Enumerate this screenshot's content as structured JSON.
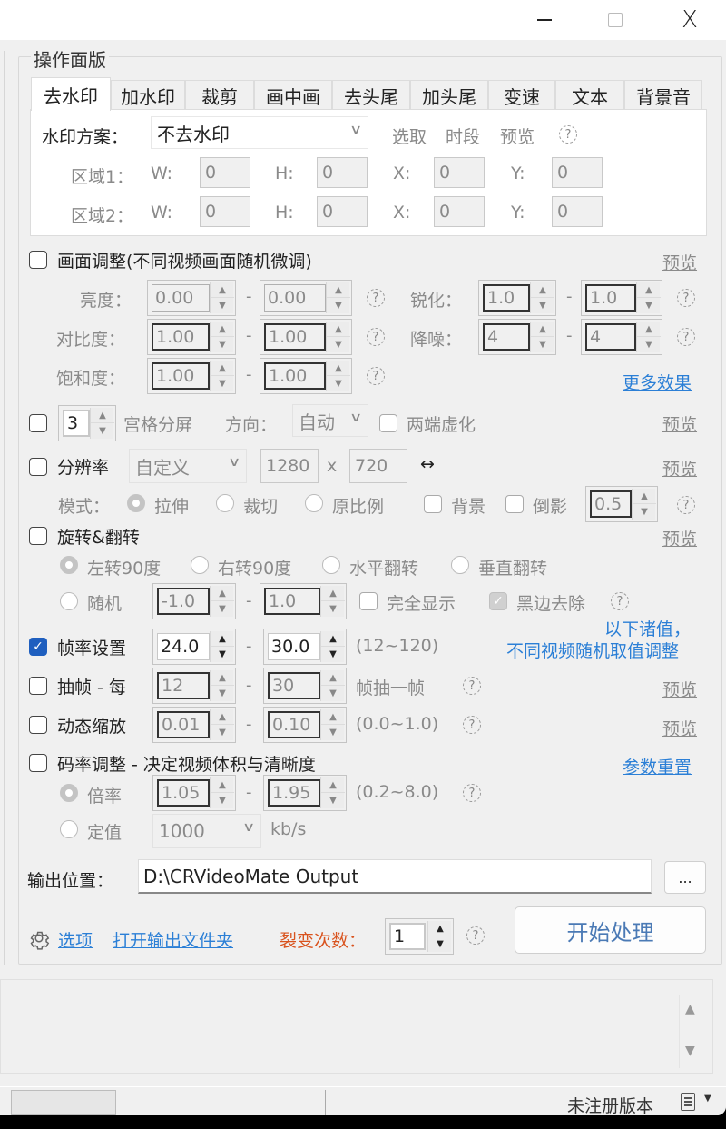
{
  "window": {
    "controls": {
      "minimize": "minimize",
      "maximize": "maximize",
      "close": "X"
    }
  },
  "panel": {
    "title": "操作面版",
    "tabs": [
      {
        "label": "去水印",
        "active": true
      },
      {
        "label": "加水印"
      },
      {
        "label": "裁剪"
      },
      {
        "label": "画中画"
      },
      {
        "label": "去头尾"
      },
      {
        "label": "加头尾"
      },
      {
        "label": "变速"
      },
      {
        "label": "文本"
      },
      {
        "label": "背景音"
      }
    ],
    "watermark": {
      "scheme_label": "水印方案：",
      "scheme_value": "不去水印",
      "links": [
        "选取",
        "时段",
        "预览"
      ],
      "help": "?",
      "regions": [
        {
          "label": "区域1：",
          "w": "0",
          "h": "0",
          "x": "0",
          "y": "0"
        },
        {
          "label": "区域2：",
          "w": "0",
          "h": "0",
          "x": "0",
          "y": "0"
        }
      ],
      "w_label": "W:",
      "h_label": "H:",
      "x_label": "X:",
      "y_label": "Y:"
    }
  },
  "picture_adjust": {
    "checked": false,
    "label": "画面调整(不同视频画面随机微调)",
    "preview": "预览",
    "brightness": {
      "label": "亮度：",
      "min": "0.00",
      "max": "0.00"
    },
    "contrast": {
      "label": "对比度：",
      "min": "1.00",
      "max": "1.00"
    },
    "saturation": {
      "label": "饱和度：",
      "min": "1.00",
      "max": "1.00"
    },
    "sharpen": {
      "label": "锐化：",
      "min": "1.0",
      "max": "1.0"
    },
    "denoise": {
      "label": "降噪：",
      "min": "4",
      "max": "4"
    },
    "more_effects": "更多效果",
    "dash": "-"
  },
  "grid_split": {
    "checked": false,
    "count": "3",
    "label": "宫格分屏",
    "direction_label": "方向：",
    "direction_value": "自动",
    "blur_ends_label": "两端虚化",
    "blur_ends_checked": false,
    "preview": "预览"
  },
  "resolution": {
    "checked": false,
    "label": "分辨率",
    "preset": "自定义",
    "width": "1280",
    "x": "x",
    "height": "720",
    "swap_icon": "↔",
    "preview": "预览",
    "mode_label": "模式：",
    "modes": [
      {
        "label": "拉伸",
        "selected": true
      },
      {
        "label": "裁切",
        "selected": false
      },
      {
        "label": "原比例",
        "selected": false
      }
    ],
    "background_label": "背景",
    "reflection_label": "倒影",
    "reflection_value": "0.5"
  },
  "rotate": {
    "checked": false,
    "label": "旋转&翻转",
    "preview": "预览",
    "options": [
      {
        "label": "左转90度",
        "selected": true
      },
      {
        "label": "右转90度",
        "selected": false
      },
      {
        "label": "水平翻转",
        "selected": false
      },
      {
        "label": "垂直翻转",
        "selected": false
      }
    ],
    "random_label": "随机",
    "random_min": "-1.0",
    "random_max": "1.0",
    "full_display_label": "完全显示",
    "remove_black_label": "黑边去除"
  },
  "random_note": {
    "line1": "以下诸值，",
    "line2": "不同视频随机取值调整"
  },
  "framerate": {
    "checked": true,
    "label": "帧率设置",
    "min": "24.0",
    "max": "30.0",
    "range": "(12~120)"
  },
  "frame_drop": {
    "checked": false,
    "label": "抽帧 - 每",
    "min": "12",
    "max": "30",
    "suffix": "帧抽一帧",
    "preview": "预览"
  },
  "dynamic_zoom": {
    "checked": false,
    "label": "动态缩放",
    "min": "0.01",
    "max": "0.10",
    "range": "(0.0~1.0)",
    "preview": "预览"
  },
  "bitrate": {
    "checked": false,
    "label": "码率调整 - 决定视频体积与清晰度",
    "reset": "参数重置",
    "ratio_label": "倍率",
    "ratio_selected": true,
    "ratio_min": "1.05",
    "ratio_max": "1.95",
    "ratio_range": "(0.2~8.0)",
    "fixed_label": "定值",
    "fixed_value": "1000",
    "unit": "kb/s"
  },
  "output": {
    "label": "输出位置：",
    "path": "D:\\CRVideoMate Output",
    "browse": "..."
  },
  "footer": {
    "options": "选项",
    "open_folder": "打开输出文件夹",
    "fission_label": "裂变次数：",
    "fission_value": "1",
    "start": "开始处理"
  },
  "statusbar": {
    "progress": 0,
    "version": "未注册版本"
  }
}
